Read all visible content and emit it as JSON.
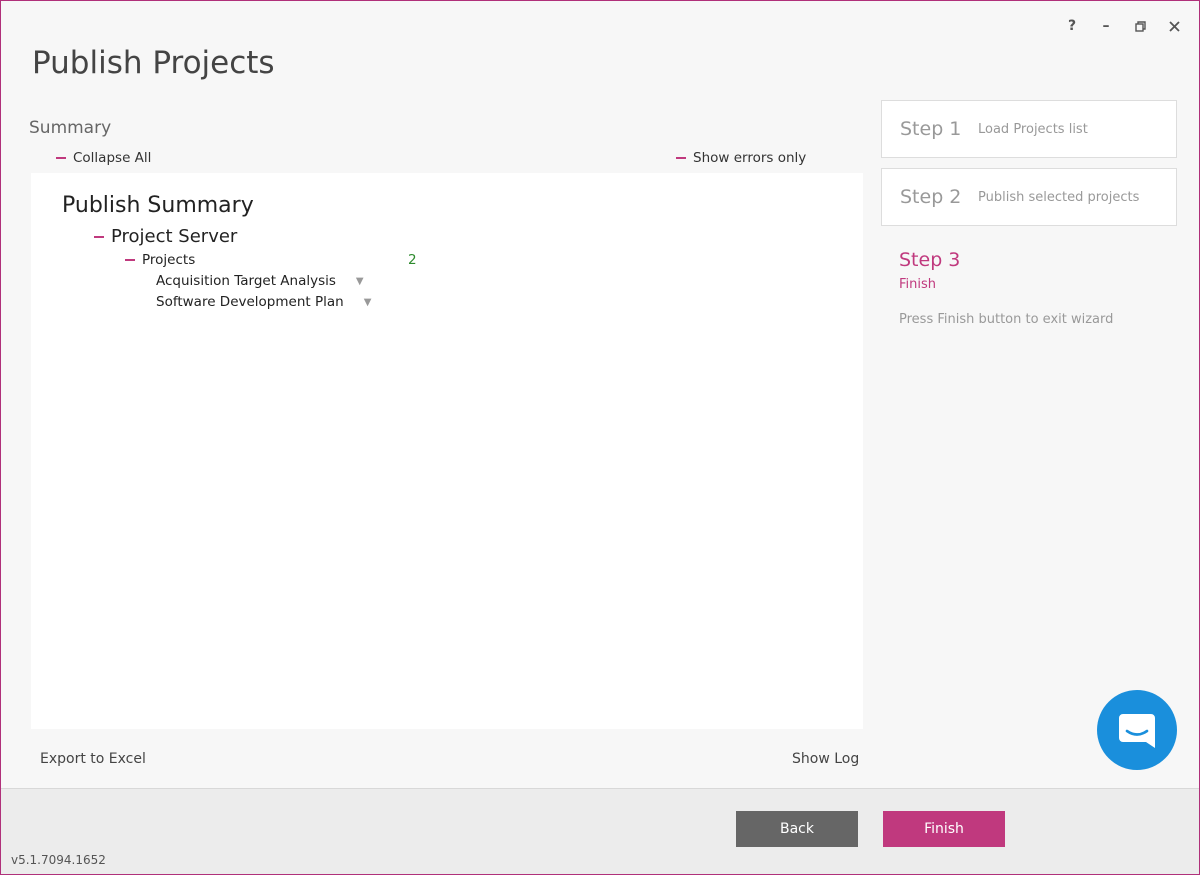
{
  "window": {
    "title": "Publish Projects",
    "controls": {
      "help": "?",
      "minimize": "–"
    }
  },
  "summary": {
    "label": "Summary",
    "collapse_all": "Collapse All",
    "show_errors_only": "Show errors only",
    "tree": {
      "title": "Publish Summary",
      "server": "Project Server",
      "projects_label": "Projects",
      "projects_count": "2",
      "projects": [
        "Acquisition Target Analysis",
        "Software Development Plan"
      ]
    },
    "export_to_excel": "Export to Excel",
    "show_log": "Show Log"
  },
  "steps": [
    {
      "num": "Step 1",
      "desc": "Load Projects list"
    },
    {
      "num": "Step 2",
      "desc": "Publish selected projects"
    },
    {
      "num": "Step 3",
      "name": "Finish",
      "hint": "Press Finish button to exit wizard"
    }
  ],
  "footer": {
    "back": "Back",
    "finish": "Finish",
    "version": "v5.1.7094.1652"
  },
  "colors": {
    "accent": "#c0397e",
    "chat": "#1a8fdc",
    "back_button": "#666666",
    "count": "#2e8b2e"
  }
}
